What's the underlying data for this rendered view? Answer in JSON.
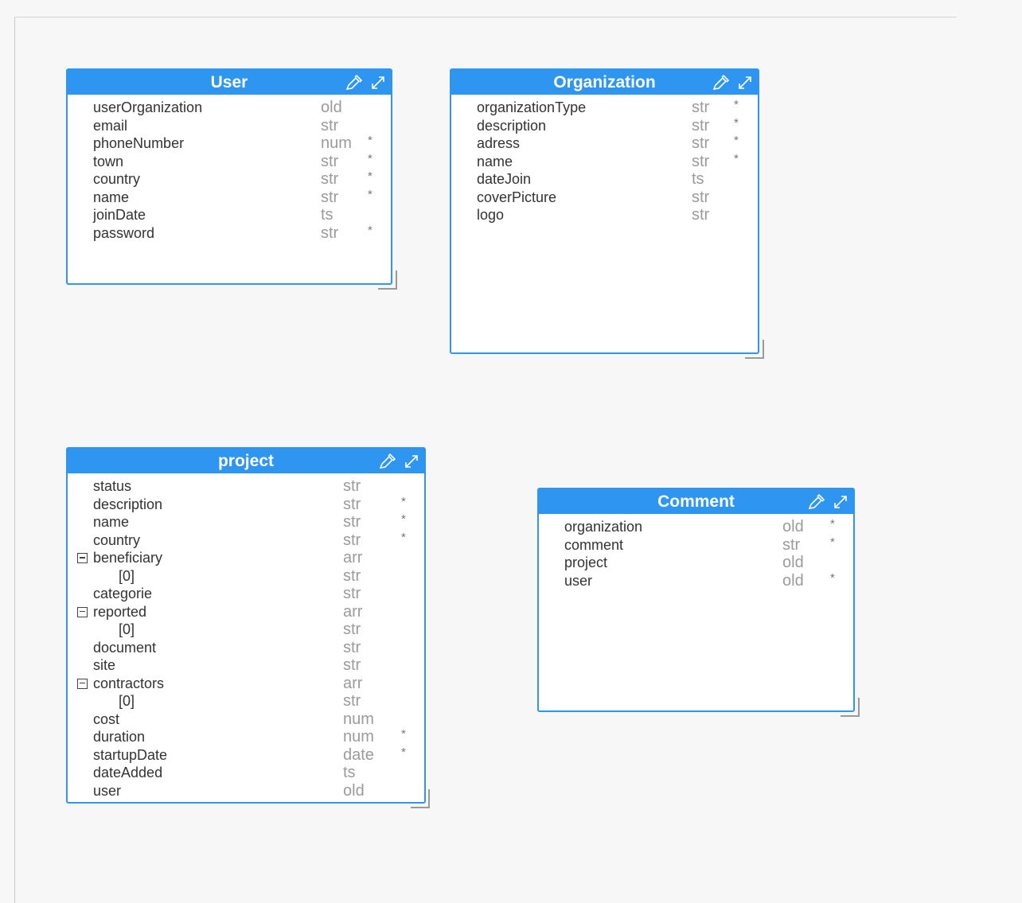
{
  "colors": {
    "header": "#2e96f0",
    "type_text": "#9b9b9b",
    "field_text": "#333333"
  },
  "icons": {
    "edit": "eyedropper-icon",
    "expand": "expand-icon",
    "toggle": "collapse-minus-icon"
  },
  "entities": [
    {
      "id": "user",
      "title": "User",
      "fields": [
        {
          "name": "userOrganization",
          "type": "old",
          "required": ""
        },
        {
          "name": "email",
          "type": "str",
          "required": ""
        },
        {
          "name": "phoneNumber",
          "type": "num",
          "required": "*"
        },
        {
          "name": "town",
          "type": "str",
          "required": "*"
        },
        {
          "name": "country",
          "type": "str",
          "required": "*"
        },
        {
          "name": "name",
          "type": "str",
          "required": "*"
        },
        {
          "name": "joinDate",
          "type": "ts",
          "required": ""
        },
        {
          "name": "password",
          "type": "str",
          "required": "*"
        }
      ]
    },
    {
      "id": "organization",
      "title": "Organization",
      "fields": [
        {
          "name": "organizationType",
          "type": "str",
          "required": "*"
        },
        {
          "name": "description",
          "type": "str",
          "required": "*"
        },
        {
          "name": "adress",
          "type": "str",
          "required": "*"
        },
        {
          "name": "name",
          "type": "str",
          "required": "*"
        },
        {
          "name": "dateJoin",
          "type": "ts",
          "required": ""
        },
        {
          "name": "coverPicture",
          "type": "str",
          "required": ""
        },
        {
          "name": "logo",
          "type": "str",
          "required": ""
        }
      ]
    },
    {
      "id": "project",
      "title": "project",
      "fields": [
        {
          "name": "status",
          "type": "str",
          "required": ""
        },
        {
          "name": "description",
          "type": "str",
          "required": "*"
        },
        {
          "name": "name",
          "type": "str",
          "required": "*"
        },
        {
          "name": "country",
          "type": "str",
          "required": "*"
        },
        {
          "name": "beneficiary",
          "type": "arr",
          "required": "",
          "collapsible": true
        },
        {
          "name": "[0]",
          "type": "str",
          "required": "",
          "child": true
        },
        {
          "name": "categorie",
          "type": "str",
          "required": ""
        },
        {
          "name": "reported",
          "type": "arr",
          "required": "",
          "collapsible": true
        },
        {
          "name": "[0]",
          "type": "str",
          "required": "",
          "child": true
        },
        {
          "name": "document",
          "type": "str",
          "required": ""
        },
        {
          "name": "site",
          "type": "str",
          "required": ""
        },
        {
          "name": "contractors",
          "type": "arr",
          "required": "",
          "collapsible": true
        },
        {
          "name": "[0]",
          "type": "str",
          "required": "",
          "child": true
        },
        {
          "name": "cost",
          "type": "num",
          "required": ""
        },
        {
          "name": "duration",
          "type": "num",
          "required": "*"
        },
        {
          "name": "startupDate",
          "type": "date",
          "required": "*"
        },
        {
          "name": "dateAdded",
          "type": "ts",
          "required": ""
        },
        {
          "name": "user",
          "type": "old",
          "required": ""
        }
      ]
    },
    {
      "id": "comment",
      "title": "Comment",
      "fields": [
        {
          "name": "organization",
          "type": "old",
          "required": "*"
        },
        {
          "name": "comment",
          "type": "str",
          "required": "*"
        },
        {
          "name": "project",
          "type": "old",
          "required": ""
        },
        {
          "name": "user",
          "type": "old",
          "required": "*"
        }
      ]
    }
  ]
}
